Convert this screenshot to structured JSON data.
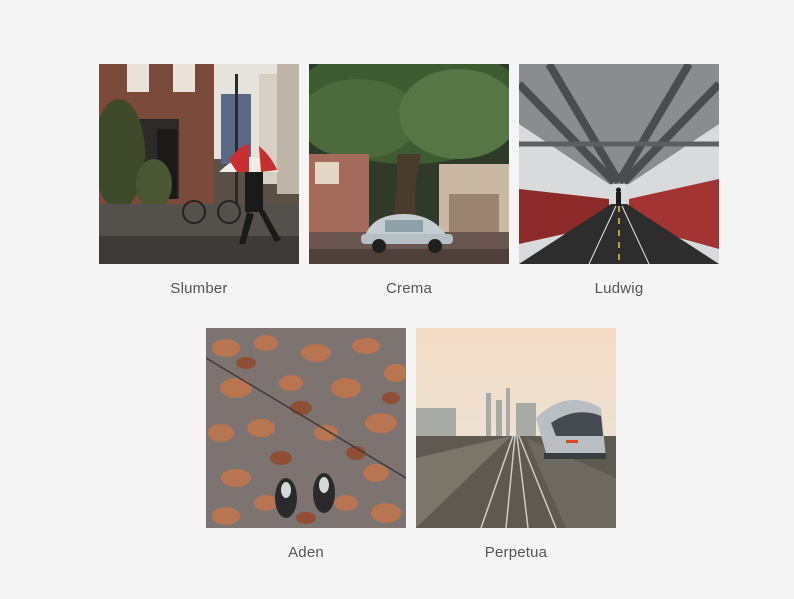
{
  "filters": [
    {
      "label": "Slumber",
      "image": "street-umbrella-photo"
    },
    {
      "label": "Crema",
      "image": "vintage-car-tree-photo"
    },
    {
      "label": "Ludwig",
      "image": "bridge-walkway-photo"
    },
    {
      "label": "Aden",
      "image": "autumn-leaves-shoes-photo"
    },
    {
      "label": "Perpetua",
      "image": "train-city-skyline-photo"
    }
  ]
}
